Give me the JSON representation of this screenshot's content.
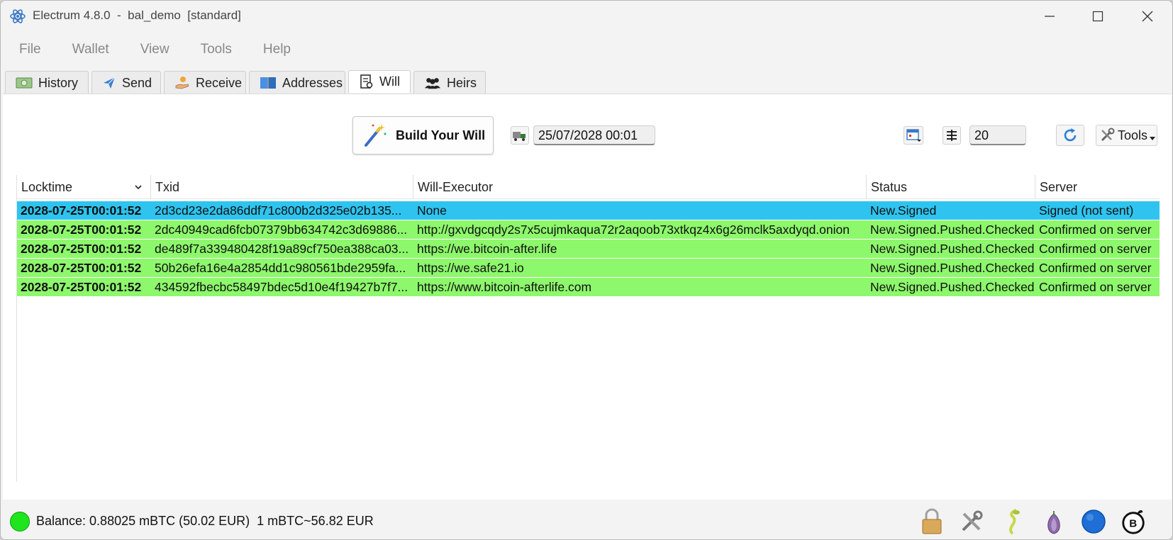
{
  "window": {
    "title": "Electrum 4.8.0  -  bal_demo  [standard]",
    "minimize_icon": "minimize-icon",
    "maximize_icon": "maximize-icon",
    "close_icon": "close-icon"
  },
  "menu": [
    "File",
    "Wallet",
    "View",
    "Tools",
    "Help"
  ],
  "tabs": [
    {
      "label": "History",
      "icon": "money-icon",
      "active": false
    },
    {
      "label": "Send",
      "icon": "paper-plane-icon",
      "active": false
    },
    {
      "label": "Receive",
      "icon": "hand-coin-icon",
      "active": false
    },
    {
      "label": "Addresses",
      "icon": "book-icon",
      "active": false
    },
    {
      "label": "Will",
      "icon": "will-document-icon",
      "active": true
    },
    {
      "label": "Heirs",
      "icon": "people-icon",
      "active": false
    }
  ],
  "toolbar": {
    "build_will_label": "Build Your Will",
    "locktime_value": "25/07/2028 00:01",
    "fee_value": "20",
    "tools_label": "Tools"
  },
  "table": {
    "columns": [
      "Locktime",
      "Txid",
      "Will-Executor",
      "Status",
      "Server"
    ],
    "rows": [
      {
        "locktime": "2028-07-25T00:01:52",
        "txid": "2d3cd23e2da86ddf71c800b2d325e02b135...",
        "executor": "None",
        "status": "New.Signed",
        "server": "Signed (not sent)",
        "color": "#2ec4ef"
      },
      {
        "locktime": "2028-07-25T00:01:52",
        "txid": "2dc40949cad6fcb07379bb634742c3d69886...",
        "executor": "http://gxvdgcqdy2s7x5cujmkaqua72r2aqoob73xtkqz4x6g26mclk5axdyqd.onion",
        "status": "New.Signed.Pushed.Checked",
        "server": "Confirmed on server",
        "color": "#8df86c"
      },
      {
        "locktime": "2028-07-25T00:01:52",
        "txid": "de489f7a339480428f19a89cf750ea388ca03...",
        "executor": "https://we.bitcoin-after.life",
        "status": "New.Signed.Pushed.Checked",
        "server": "Confirmed on server",
        "color": "#8df86c"
      },
      {
        "locktime": "2028-07-25T00:01:52",
        "txid": "50b26efa16e4a2854dd1c980561bde2959fa...",
        "executor": "https://we.safe21.io",
        "status": "New.Signed.Pushed.Checked",
        "server": "Confirmed on server",
        "color": "#8df86c"
      },
      {
        "locktime": "2028-07-25T00:01:52",
        "txid": "434592fbecbc58497bdec5d10e4f19427b7f7...",
        "executor": "https://www.bitcoin-afterlife.com",
        "status": "New.Signed.Pushed.Checked",
        "server": "Confirmed on server",
        "color": "#8df86c"
      }
    ]
  },
  "status_bar": {
    "balance_text": "Balance: 0.88025 mBTC (50.02 EUR)  1 mBTC~56.82 EUR",
    "connection_color": "#1ee51e",
    "icons": [
      "lock-icon",
      "tools-icon",
      "seed-icon",
      "tor-onion-icon",
      "network-icon",
      "bal-plugin-icon"
    ]
  }
}
